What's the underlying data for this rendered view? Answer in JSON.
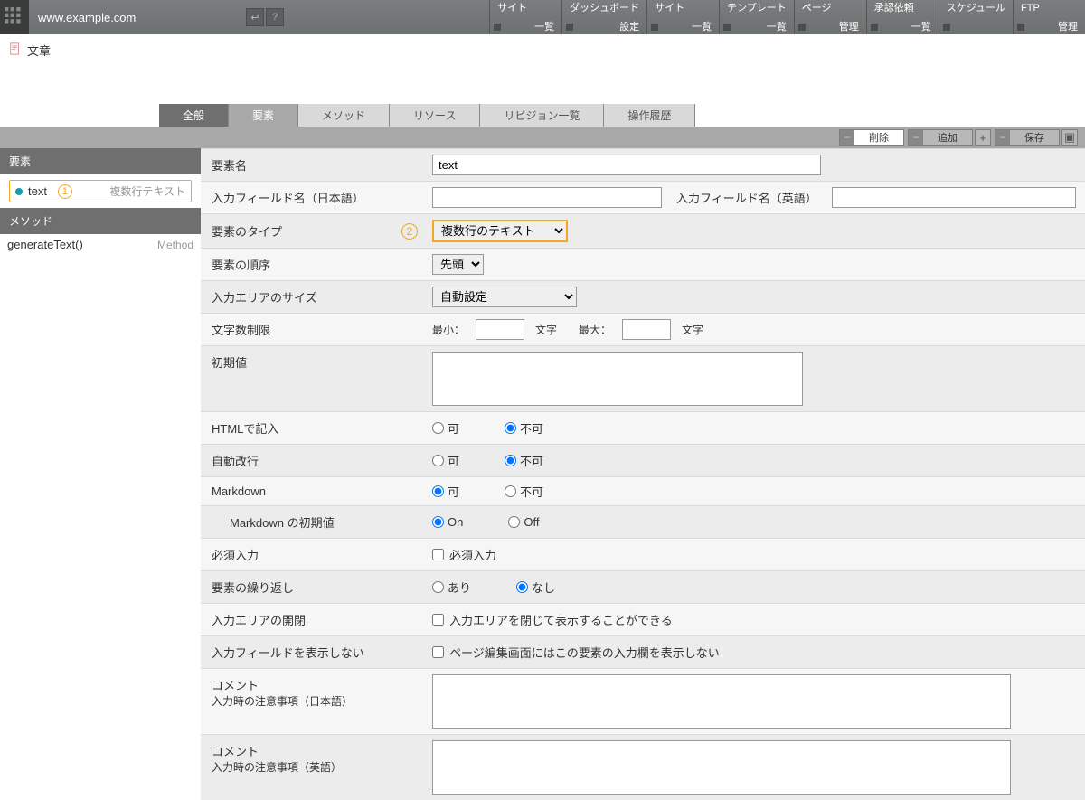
{
  "topbar": {
    "site_url": "www.example.com",
    "nav": [
      {
        "t1": "サイト",
        "t2": "一覧"
      },
      {
        "t1": "ダッシュボード",
        "t2": "設定"
      },
      {
        "t1": "サイト",
        "t2": "一覧"
      },
      {
        "t1": "テンプレート",
        "t2": "一覧"
      },
      {
        "t1": "ページ",
        "t2": "管理"
      },
      {
        "t1": "承認依頼",
        "t2": "一覧"
      },
      {
        "t1": "スケジュール",
        "t2": ""
      },
      {
        "t1": "FTP",
        "t2": "管理"
      }
    ]
  },
  "page": {
    "title": "文章"
  },
  "tabs": [
    "全般",
    "要素",
    "メソッド",
    "リソース",
    "リビジョン一覧",
    "操作履歴"
  ],
  "active_tab_index": 1,
  "toolbar": {
    "delete": "削除",
    "add": "追加",
    "save": "保存"
  },
  "sidebar": {
    "hdr_element": "要素",
    "item1_label": "text",
    "item1_num": "1",
    "item1_tag": "複数行テキスト",
    "hdr_method": "メソッド",
    "item2_label": "generateText()",
    "item2_tag": "Method"
  },
  "form": {
    "element_name": {
      "label": "要素名",
      "value": "text"
    },
    "field_ja": {
      "label": "入力フィールド名（日本語）",
      "value": ""
    },
    "field_en": {
      "label": "入力フィールド名（英語）",
      "value": ""
    },
    "element_type": {
      "label": "要素のタイプ",
      "num": "2",
      "value": "複数行のテキスト",
      "options": [
        "複数行のテキスト"
      ]
    },
    "order": {
      "label": "要素の順序",
      "value": "先頭",
      "options": [
        "先頭"
      ]
    },
    "area_size": {
      "label": "入力エリアのサイズ",
      "value": "自動設定",
      "options": [
        "自動設定"
      ]
    },
    "char_limit": {
      "label": "文字数制限",
      "min_lbl": "最小：",
      "max_lbl": "最大：",
      "unit": "文字"
    },
    "initial": {
      "label": "初期値",
      "value": ""
    },
    "html": {
      "label": "HTMLで記入",
      "yes": "可",
      "no": "不可",
      "selected": "no"
    },
    "autowrap": {
      "label": "自動改行",
      "yes": "可",
      "no": "不可",
      "selected": "no"
    },
    "markdown": {
      "label": "Markdown",
      "yes": "可",
      "no": "不可",
      "selected": "yes"
    },
    "markdown_init": {
      "label": "Markdown の初期値",
      "on": "On",
      "off": "Off",
      "selected": "on"
    },
    "required": {
      "label": "必須入力",
      "chk": "必須入力"
    },
    "repeat": {
      "label": "要素の繰り返し",
      "yes": "あり",
      "no": "なし",
      "selected": "no"
    },
    "collapse": {
      "label": "入力エリアの開閉",
      "chk": "入力エリアを閉じて表示することができる"
    },
    "hide_field": {
      "label": "入力フィールドを表示しない",
      "chk": "ページ編集画面にはこの要素の入力欄を表示しない"
    },
    "comment_ja": {
      "l1": "コメント",
      "l2": "入力時の注意事項（日本語）"
    },
    "comment_en": {
      "l1": "コメント",
      "l2": "入力時の注意事項（英語）"
    }
  }
}
